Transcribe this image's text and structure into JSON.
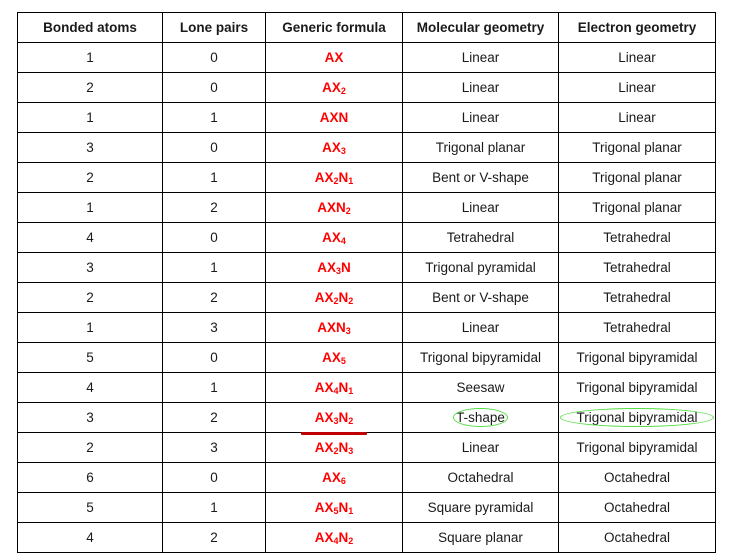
{
  "table": {
    "headers": [
      "Bonded atoms",
      "Lone pairs",
      "Generic formula",
      "Molecular geometry",
      "Electron geometry"
    ],
    "rows": [
      {
        "bonded": "1",
        "lone": "0",
        "formula": [
          {
            "t": "AX"
          }
        ],
        "molecular": "Linear",
        "electron": "Linear"
      },
      {
        "bonded": "2",
        "lone": "0",
        "formula": [
          {
            "t": "AX"
          },
          {
            "s": "2"
          }
        ],
        "molecular": "Linear",
        "electron": "Linear"
      },
      {
        "bonded": "1",
        "lone": "1",
        "formula": [
          {
            "t": "AXN"
          }
        ],
        "molecular": "Linear",
        "electron": "Linear"
      },
      {
        "bonded": "3",
        "lone": "0",
        "formula": [
          {
            "t": "AX"
          },
          {
            "s": "3"
          }
        ],
        "molecular": "Trigonal planar",
        "electron": "Trigonal planar"
      },
      {
        "bonded": "2",
        "lone": "1",
        "formula": [
          {
            "t": "AX"
          },
          {
            "s": "2"
          },
          {
            "t": "N"
          },
          {
            "s": "1"
          }
        ],
        "molecular": "Bent or V-shape",
        "electron": "Trigonal planar"
      },
      {
        "bonded": "1",
        "lone": "2",
        "formula": [
          {
            "t": "AXN"
          },
          {
            "s": "2"
          }
        ],
        "molecular": "Linear",
        "electron": "Trigonal planar"
      },
      {
        "bonded": "4",
        "lone": "0",
        "formula": [
          {
            "t": "AX"
          },
          {
            "s": "4"
          }
        ],
        "molecular": "Tetrahedral",
        "electron": "Tetrahedral"
      },
      {
        "bonded": "3",
        "lone": "1",
        "formula": [
          {
            "t": "AX"
          },
          {
            "s": "3"
          },
          {
            "t": "N"
          }
        ],
        "molecular": "Trigonal pyramidal",
        "electron": "Tetrahedral"
      },
      {
        "bonded": "2",
        "lone": "2",
        "formula": [
          {
            "t": "AX"
          },
          {
            "s": "2"
          },
          {
            "t": "N"
          },
          {
            "s": "2"
          }
        ],
        "molecular": "Bent or V-shape",
        "electron": "Tetrahedral"
      },
      {
        "bonded": "1",
        "lone": "3",
        "formula": [
          {
            "t": "AXN"
          },
          {
            "s": "3"
          }
        ],
        "molecular": "Linear",
        "electron": "Tetrahedral"
      },
      {
        "bonded": "5",
        "lone": "0",
        "formula": [
          {
            "t": "AX"
          },
          {
            "s": "5"
          }
        ],
        "molecular": "Trigonal bipyramidal",
        "electron": "Trigonal bipyramidal"
      },
      {
        "bonded": "4",
        "lone": "1",
        "formula": [
          {
            "t": "AX"
          },
          {
            "s": "4"
          },
          {
            "t": "N"
          },
          {
            "s": "1"
          }
        ],
        "molecular": "Seesaw",
        "electron": "Trigonal bipyramidal"
      },
      {
        "bonded": "3",
        "lone": "2",
        "formula": [
          {
            "t": "AX"
          },
          {
            "s": "3"
          },
          {
            "t": "N"
          },
          {
            "s": "2"
          }
        ],
        "molecular": "T-shape",
        "electron": "Trigonal bipyramidal",
        "highlighted": true
      },
      {
        "bonded": "2",
        "lone": "3",
        "formula": [
          {
            "t": "AX"
          },
          {
            "s": "2"
          },
          {
            "t": "N"
          },
          {
            "s": "3"
          }
        ],
        "molecular": "Linear",
        "electron": "Trigonal bipyramidal"
      },
      {
        "bonded": "6",
        "lone": "0",
        "formula": [
          {
            "t": "AX"
          },
          {
            "s": "6"
          }
        ],
        "molecular": "Octahedral",
        "electron": "Octahedral"
      },
      {
        "bonded": "5",
        "lone": "1",
        "formula": [
          {
            "t": "AX"
          },
          {
            "s": "5"
          },
          {
            "t": "N"
          },
          {
            "s": "1"
          }
        ],
        "molecular": "Square pyramidal",
        "electron": "Octahedral"
      },
      {
        "bonded": "4",
        "lone": "2",
        "formula": [
          {
            "t": "AX"
          },
          {
            "s": "4"
          },
          {
            "t": "N"
          },
          {
            "s": "2"
          }
        ],
        "molecular": "Square planar",
        "electron": "Octahedral"
      }
    ]
  },
  "annotations": {
    "underline_color": "#c00000",
    "ellipse_color": "#55dd44",
    "formula_color": "#ff0000"
  }
}
